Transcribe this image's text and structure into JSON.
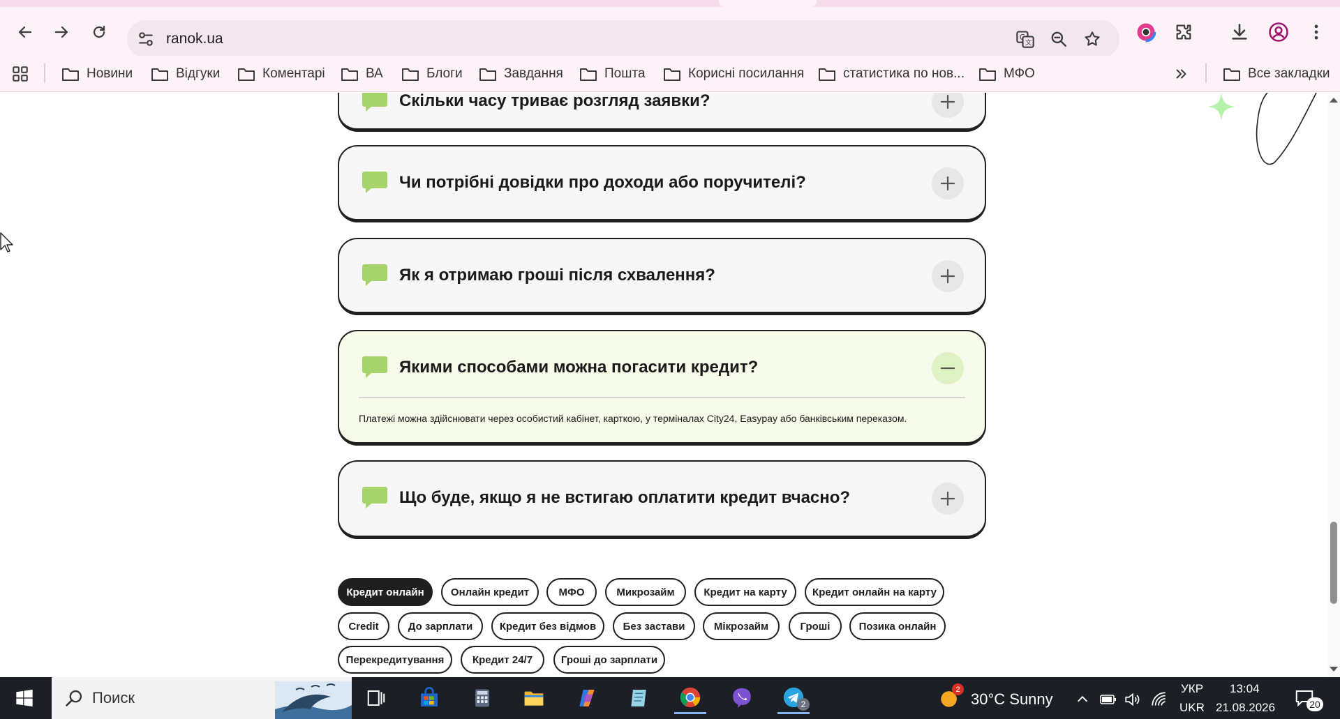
{
  "browser": {
    "url": "ranok.ua",
    "bookmarks": [
      "Новини",
      "Відгуки",
      "Коментарі",
      "ВА",
      "Блоги",
      "Завдання",
      "Пошта",
      "Корисні посилання",
      "статистика по нов...",
      "МФО"
    ],
    "all_bookmarks": "Все закладки"
  },
  "faq": [
    {
      "question": "Скільки часу триває розгляд заявки?",
      "state": "collapsed"
    },
    {
      "question": "Чи потрібні довідки про доходи або поручителі?",
      "state": "collapsed"
    },
    {
      "question": "Як я отримаю гроші після схвалення?",
      "state": "collapsed"
    },
    {
      "question": "Якими способами можна погасити кредит?",
      "state": "expanded",
      "answer": "Платежі можна здійснювати через особистий кабінет, карткою, у терміналах City24, Easypay або банківським переказом."
    },
    {
      "question": "Що буде, якщо я не встигаю оплатити кредит вчасно?",
      "state": "collapsed"
    }
  ],
  "faq_badge": "?",
  "tags": [
    [
      "Кредит онлайн",
      "Онлайн кредит",
      "МФО",
      "Микрозайм",
      "Кредит на карту",
      "Кредит онлайн на карту"
    ],
    [
      "Credit",
      "До зарплати",
      "Кредит без відмов",
      "Без застави",
      "Мікрозайм",
      "Гроші",
      "Позика онлайн"
    ],
    [
      "Перекредитування",
      "Кредит 24/7",
      "Гроші до зарплати"
    ]
  ],
  "active_tag": "Кредит онлайн",
  "taskbar": {
    "search_label": "Поиск",
    "weather": "30°C  Sunny",
    "weather_badge": "2",
    "telegram_badge": "2",
    "lang_top": "УКР",
    "lang_bottom": "UKR",
    "time": "13:04",
    "date": "21.08.2026",
    "notifications": "20"
  },
  "colors": {
    "accent_green": "#a6d36b",
    "card_border": "#1f1f1f",
    "card_bg": "#f7f7f7",
    "card_open_bg": "#f6fbea",
    "chrome_bg": "#fdf2f8"
  }
}
